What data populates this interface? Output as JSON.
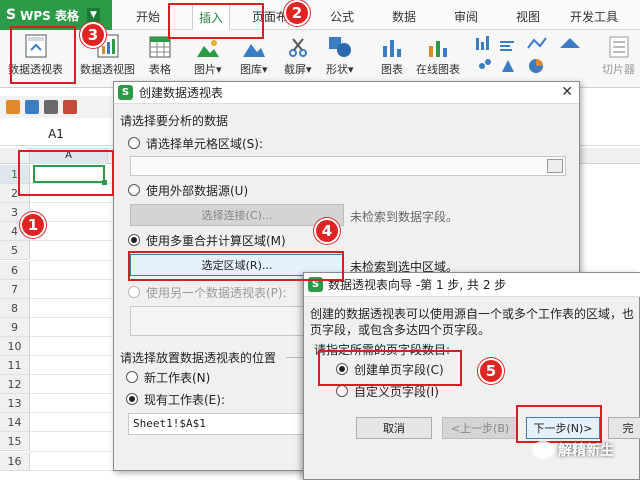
{
  "app": {
    "name": "WPS 表格",
    "dropdown_glyph": "▼",
    "logo_glyph": "S"
  },
  "tabs": [
    "开始",
    "插入",
    "页面布",
    "公式",
    "数据",
    "审阅",
    "视图",
    "开发工具"
  ],
  "active_tab": "插入",
  "ribbon": {
    "pivot_table": "数据透视表",
    "pivot_chart": "数据透视图",
    "table": "表格",
    "picture": "图片",
    "gallery": "图库",
    "screenshot": "截屏",
    "shapes": "形状",
    "chart": "图表",
    "online_chart": "在线图表",
    "slicer": "切片器",
    "dropdown_glyph": "▾"
  },
  "sheet": {
    "name_box": "A1",
    "column_a": "A",
    "row_numbers": [
      "1",
      "2",
      "3",
      "4",
      "5",
      "6",
      "7",
      "8",
      "9",
      "10",
      "11",
      "12",
      "13",
      "14",
      "15",
      "16"
    ]
  },
  "dialog_create": {
    "title": "创建数据透视表",
    "close_glyph": "✕",
    "section_data": "请选择要分析的数据",
    "opt_range": "请选择单元格区域(S):",
    "opt_external": "使用外部数据源(U)",
    "choose_connection_btn": "选择连接(C)...",
    "no_field_text": "未检索到数据字段。",
    "opt_multi": "使用多重合并计算区域(M)",
    "select_area_btn": "选定区域(R)...",
    "no_area_text": "未检索到选中区域。",
    "opt_other_pivot": "使用另一个数据透视表(P):",
    "section_location": "请选择放置数据透视表的位置",
    "opt_new_sheet": "新工作表(N)",
    "opt_existing_sheet": "现有工作表(E):",
    "location_value": "Sheet1!$A$1",
    "ok_btn": "确定",
    "cancel_btn": "取消"
  },
  "dialog_wizard": {
    "title": "数据透视表向导 -第 1 步, 共 2 步",
    "desc_line1": "创建的数据透视表可以使用源自一个或多个工作表的区域，也",
    "desc_line2": "页字段，或包含多达四个页字段。",
    "prompt": "请指定所需的页字段数目:",
    "opt_single": "创建单页字段(C)",
    "opt_custom": "自定义页字段(I)",
    "cancel_btn": "取消",
    "prev_btn": "<上一步(B)",
    "next_btn": "下一步(N)>",
    "finish_btn": "完"
  },
  "markers": [
    "1",
    "2",
    "3",
    "4",
    "5"
  ],
  "watermark": "解精新生",
  "colors": {
    "brand_green": "#2b9b48",
    "marker_red": "#e02424"
  }
}
